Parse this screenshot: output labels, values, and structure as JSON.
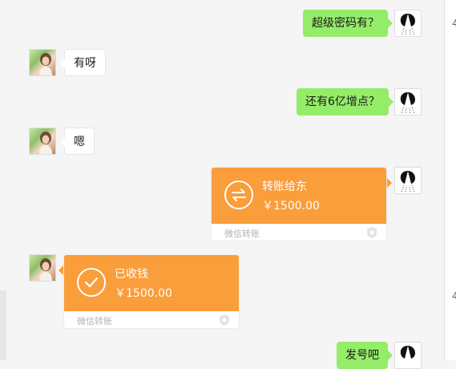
{
  "colors": {
    "outgoing_bubble": "#95ec69",
    "incoming_bubble": "#ffffff",
    "transfer_orange": "#fa9d3b",
    "background": "#f5f5f5"
  },
  "messages": [
    {
      "direction": "out",
      "text": "超级密码有？"
    },
    {
      "direction": "in",
      "text": "有呀"
    },
    {
      "direction": "out",
      "text": "还有6亿增点？"
    },
    {
      "direction": "in",
      "text": "嗯"
    },
    {
      "direction": "out",
      "type": "transfer",
      "title": "转账给东",
      "amount": "￥1500.00",
      "footer": "微信转账",
      "icon": "transfer-arrows-icon"
    },
    {
      "direction": "in",
      "type": "transfer",
      "title": "已收钱",
      "amount": "￥1500.00",
      "footer": "微信转账",
      "icon": "check-circle-icon"
    },
    {
      "direction": "out",
      "text": "发号吧"
    }
  ],
  "right_strip": {
    "marks": [
      "4",
      "4"
    ]
  }
}
